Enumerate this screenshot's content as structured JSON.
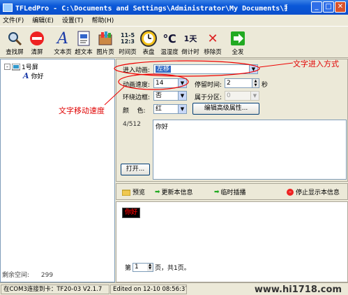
{
  "window": {
    "title": "TFLedPro - C:\\Documents and Settings\\Administrator\\My Documents\\我的显示..."
  },
  "menu": [
    "文件(F)",
    "编辑(E)",
    "设置(T)",
    "帮助(H)"
  ],
  "toolbar": [
    {
      "label": "查找屏",
      "icon": "search-icon"
    },
    {
      "label": "清屏",
      "icon": "stop-icon"
    },
    {
      "label": "文本页",
      "icon": "text-a-icon"
    },
    {
      "label": "超文本",
      "icon": "document-icon"
    },
    {
      "label": "图片页",
      "icon": "picture-icon"
    },
    {
      "label": "时间页",
      "icon": "time-digits-icon",
      "glyph": "11-5\n12:3"
    },
    {
      "label": "表盘",
      "icon": "clock-icon"
    },
    {
      "label": "温湿度",
      "icon": "celsius-icon",
      "glyph": "℃"
    },
    {
      "label": "倒计时",
      "icon": "countdown-icon",
      "glyph": "1天"
    },
    {
      "label": "移除页",
      "icon": "delete-x-icon",
      "glyph": "✕"
    },
    {
      "label": "全发",
      "icon": "send-arrow-icon"
    }
  ],
  "tree": {
    "root": "1号屏",
    "child": "你好"
  },
  "remaining": {
    "label": "剩余空间:",
    "value": "299"
  },
  "form": {
    "enter_anim_label": "进入动画:",
    "enter_anim_value": "左移",
    "speed_label": "动画速度:",
    "speed_value": "14",
    "stay_label": "停留时间:",
    "stay_value": "2",
    "stay_unit": "秒",
    "border_label": "环绕边框:",
    "border_value": "否",
    "partition_label": "属于分区:",
    "partition_value": "0",
    "color_label": "颜    色:",
    "color_value": "红",
    "advanced_button": "编辑高级属性...",
    "char_count": "4/512",
    "text_content": "你好",
    "open_button": "打开..."
  },
  "annotations": {
    "enter_mode": "文字进入方式",
    "move_speed": "文字移动速度"
  },
  "actions": {
    "preview": "预览",
    "update": "更新本信息",
    "insert": "临时插播",
    "stop": "停止显示本信息"
  },
  "preview": {
    "page_prefix": "第",
    "page_value": "1",
    "page_suffix": "页，共1页。"
  },
  "status": {
    "conn": "在COM3连接到卡：TF20-03 V2.1.7",
    "edited": "Edited on 12-10 08:56:37"
  },
  "watermark": "www.hi1718.com"
}
